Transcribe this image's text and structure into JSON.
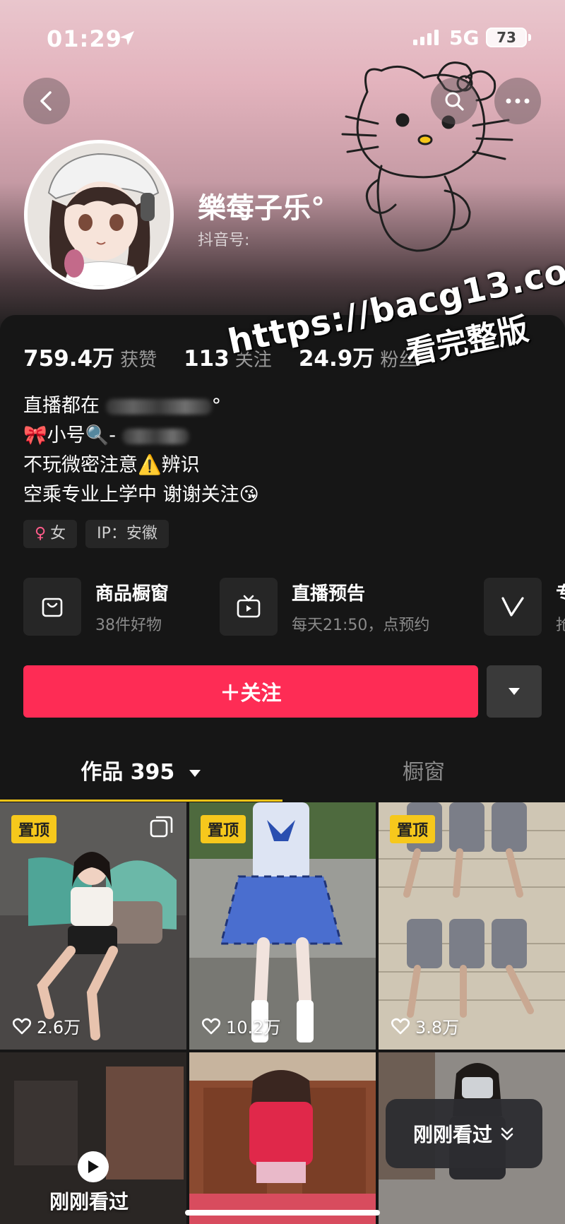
{
  "status_bar": {
    "time": "01:29",
    "network": "5G",
    "battery": "73"
  },
  "profile": {
    "nickname": "樂莓子乐°",
    "douyin_id_label": "抖音号:",
    "stats": [
      {
        "value": "759.4万",
        "label": "获赞"
      },
      {
        "value": "113",
        "label": "关注"
      },
      {
        "value": "24.9万",
        "label": "粉丝"
      }
    ],
    "bio": [
      "直播都在",
      "小号",
      "不玩微密注意⚠️辨识",
      "空乘专业上学中 谢谢关注😘"
    ],
    "bio_suffix_1": "°",
    "bio_suffix_2": "-",
    "tags": {
      "gender": "女",
      "ip": "IP：安徽"
    }
  },
  "services": [
    {
      "title": "商品橱窗",
      "subtitle": "38件好物"
    },
    {
      "title": "直播预告",
      "subtitle": "每天21:50，点预约"
    },
    {
      "title": "专",
      "subtitle": "抢"
    }
  ],
  "actions": {
    "follow": "＋关注"
  },
  "tabs": {
    "works": "作品 395",
    "window": "橱窗"
  },
  "grid": [
    {
      "pinned": "置顶",
      "likes": "2.6万"
    },
    {
      "pinned": "置顶",
      "likes": "10.2万"
    },
    {
      "pinned": "置顶",
      "likes": "3.8万"
    }
  ],
  "just_viewed_cell": "刚刚看过",
  "recent_pill": "刚刚看过",
  "watermark": {
    "line1": "https://bacg13.com",
    "line2": "看完整版"
  },
  "colors": {
    "follow": "#fe2c55",
    "accent_underline": "#f5c518",
    "pin_badge": "#f6c81c",
    "background": "#161616"
  }
}
